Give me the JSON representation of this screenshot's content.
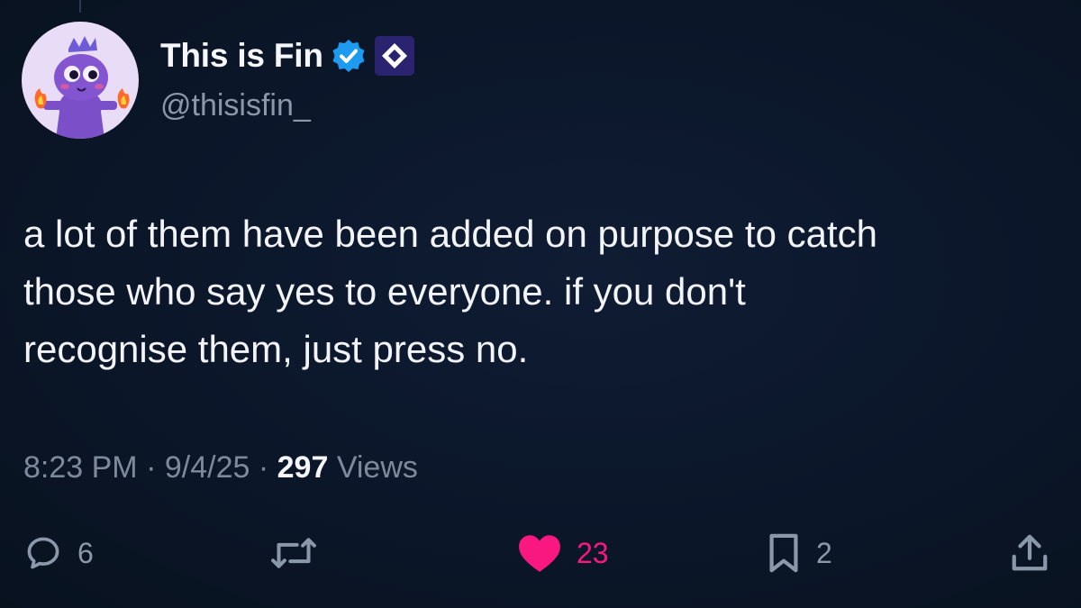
{
  "author": {
    "display_name": "This is Fin",
    "handle": "@thisisfin_",
    "verified_icon": "verified-badge-icon",
    "affiliate_icon": "affiliate-badge-icon",
    "avatar_icon": "purple-crowned-creature-avatar"
  },
  "tweet": {
    "lines": [
      "a lot of them have been added on purpose to catch",
      "those who say yes to everyone. if you don't",
      "recognise them, just press no."
    ]
  },
  "meta": {
    "time": "8:23 PM",
    "separator": "·",
    "date": "9/4/25",
    "views_count": "297",
    "views_label": "Views"
  },
  "actions": {
    "replies": {
      "icon": "reply-icon",
      "count": "6"
    },
    "reposts": {
      "icon": "repost-icon"
    },
    "likes": {
      "icon": "heart-icon",
      "count": "23",
      "liked": true
    },
    "bookmarks": {
      "icon": "bookmark-icon",
      "count": "2"
    },
    "share": {
      "icon": "share-icon"
    }
  },
  "colors": {
    "background": "#0b1629",
    "text": "#f2f4f7",
    "muted": "#8b98a9",
    "verified": "#1d9bf0",
    "like": "#f91880",
    "affiliate_bg": "#2a2470"
  }
}
